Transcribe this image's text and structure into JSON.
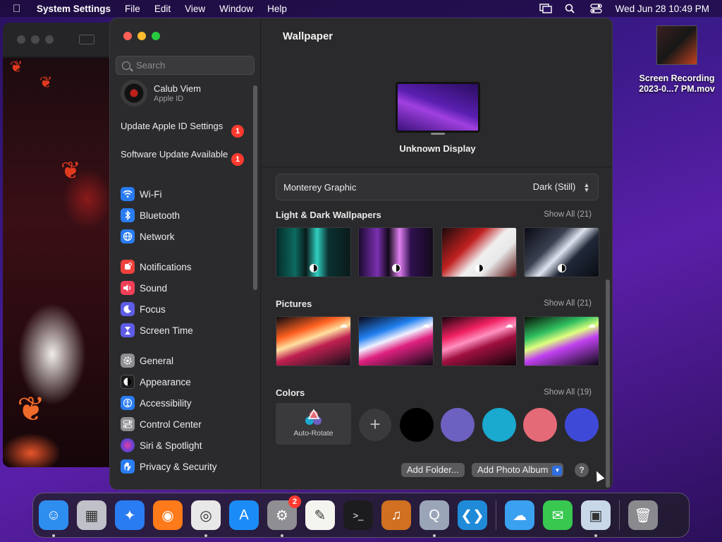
{
  "menubar": {
    "app_name": "System Settings",
    "menus": [
      "File",
      "Edit",
      "View",
      "Window",
      "Help"
    ],
    "clock": "Wed Jun 28  10:49 PM"
  },
  "desktop": {
    "file_label": "Screen Recording 2023-0...7 PM.mov"
  },
  "sidebar": {
    "search_placeholder": "Search",
    "account_name": "Calub Viem",
    "account_sub": "Apple ID",
    "notices": [
      {
        "label": "Update Apple ID Settings",
        "badge": "1"
      },
      {
        "label": "Software Update Available",
        "badge": "1"
      }
    ],
    "items": [
      {
        "label": "Wi-Fi",
        "icon": "wifi-icon",
        "color": "#2a7cf2"
      },
      {
        "label": "Bluetooth",
        "icon": "bluetooth-icon",
        "color": "#2a7cf2"
      },
      {
        "label": "Network",
        "icon": "globe-icon",
        "color": "#2a7cf2"
      },
      {
        "label": "Notifications",
        "icon": "bell-icon",
        "color": "#f0423c"
      },
      {
        "label": "Sound",
        "icon": "speaker-icon",
        "color": "#f03f58"
      },
      {
        "label": "Focus",
        "icon": "moon-icon",
        "color": "#5e5ce6"
      },
      {
        "label": "Screen Time",
        "icon": "hourglass-icon",
        "color": "#5e5ce6"
      },
      {
        "label": "General",
        "icon": "gear-icon",
        "color": "#8e8e93"
      },
      {
        "label": "Appearance",
        "icon": "appearance-icon",
        "color": "#1c1c1e"
      },
      {
        "label": "Accessibility",
        "icon": "accessibility-icon",
        "color": "#2a7cf2"
      },
      {
        "label": "Control Center",
        "icon": "control-center-icon",
        "color": "#8e8e93"
      },
      {
        "label": "Siri & Spotlight",
        "icon": "siri-icon",
        "color": "#7a3fd0"
      },
      {
        "label": "Privacy & Security",
        "icon": "hand-icon",
        "color": "#2a7cf2"
      }
    ]
  },
  "content": {
    "title": "Wallpaper",
    "display_name": "Unknown Display",
    "wallpaper_name": "Monterey Graphic",
    "wallpaper_mode": "Dark (Still)",
    "sections": [
      {
        "title": "Light & Dark Wallpapers",
        "show_all": "Show All (21)"
      },
      {
        "title": "Pictures",
        "show_all": "Show All (21)"
      },
      {
        "title": "Colors",
        "show_all": "Show All (19)"
      }
    ],
    "auto_rotate_label": "Auto-Rotate",
    "color_swatches": [
      "#000000",
      "#6c61c0",
      "#1aa9cf",
      "#e56a78",
      "#3f49d8"
    ],
    "add_folder_label": "Add Folder...",
    "add_album_label": "Add Photo Album",
    "help_label": "?"
  },
  "dock": {
    "apps": [
      {
        "name": "finder-icon",
        "color": "#2e8ef0",
        "running": true
      },
      {
        "name": "launchpad-icon",
        "color": "#c0c0c8",
        "running": false
      },
      {
        "name": "safari-icon",
        "color": "#2a7cf2",
        "running": false
      },
      {
        "name": "firefox-icon",
        "color": "#ff7a1a",
        "running": false
      },
      {
        "name": "chrome-icon",
        "color": "#e8e8e8",
        "running": true
      },
      {
        "name": "app-store-icon",
        "color": "#1b8cf7",
        "running": false
      },
      {
        "name": "system-settings-icon",
        "color": "#8e8e93",
        "running": true,
        "badge": "2"
      },
      {
        "name": "textedit-icon",
        "color": "#f5f5f0",
        "running": false
      },
      {
        "name": "terminal-icon",
        "color": "#1c1c1e",
        "running": false
      },
      {
        "name": "garageband-icon",
        "color": "#d07020",
        "running": false
      },
      {
        "name": "quicktime-icon",
        "color": "#9aa6b8",
        "running": true
      },
      {
        "name": "vscode-icon",
        "color": "#1f8ad8",
        "running": false
      },
      {
        "name": "weather-icon",
        "color": "#3aa0f0",
        "running": false
      },
      {
        "name": "messages-icon",
        "color": "#38c850",
        "running": false
      },
      {
        "name": "preview-icon",
        "color": "#c8d8e8",
        "running": true
      },
      {
        "name": "trash-icon",
        "color": "#8a8a8e",
        "running": false
      }
    ]
  }
}
